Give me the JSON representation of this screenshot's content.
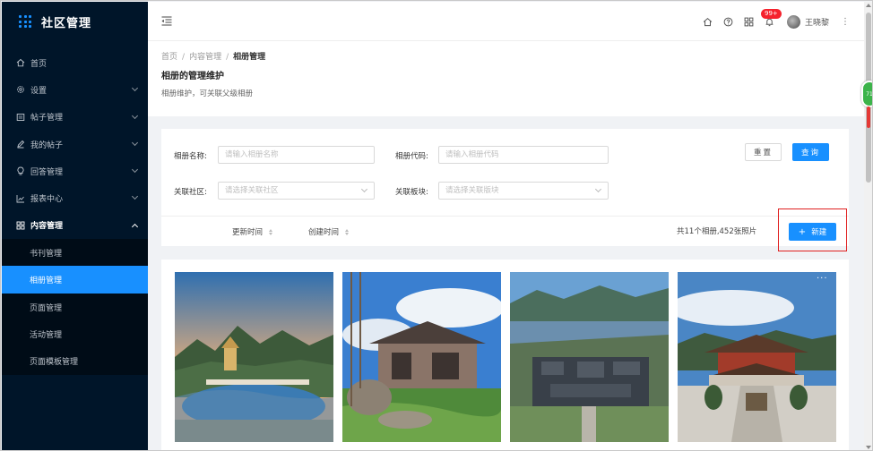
{
  "app": {
    "title": "社区管理"
  },
  "sidebar": {
    "items": [
      {
        "label": "首页",
        "icon": "home-icon",
        "has_arrow": false
      },
      {
        "label": "设置",
        "icon": "gear-icon",
        "has_arrow": true
      },
      {
        "label": "帖子管理",
        "icon": "post-icon",
        "has_arrow": true
      },
      {
        "label": "我的帖子",
        "icon": "edit-icon",
        "has_arrow": true
      },
      {
        "label": "回答管理",
        "icon": "bulb-icon",
        "has_arrow": true
      },
      {
        "label": "报表中心",
        "icon": "chart-icon",
        "has_arrow": true
      },
      {
        "label": "内容管理",
        "icon": "apps-icon",
        "has_arrow": true,
        "open": true
      }
    ],
    "subitems": [
      {
        "label": "书刊管理",
        "active": false
      },
      {
        "label": "相册管理",
        "active": true
      },
      {
        "label": "页面管理",
        "active": false
      },
      {
        "label": "活动管理",
        "active": false
      },
      {
        "label": "页面模板管理",
        "active": false
      }
    ]
  },
  "header": {
    "badge": "99+",
    "username": "王晓黎"
  },
  "breadcrumb": {
    "home": "首页",
    "parent": "内容管理",
    "current": "相册管理",
    "separator": "/"
  },
  "page": {
    "title": "相册的管理维护",
    "desc": "相册维护，可关联父级相册"
  },
  "filter": {
    "name_label": "相册名称:",
    "name_placeholder": "请输入相册名称",
    "code_label": "相册代码:",
    "code_placeholder": "请输入相册代码",
    "community_label": "关联社区:",
    "community_placeholder": "请选择关联社区",
    "board_label": "关联板块:",
    "board_placeholder": "请选择关联版块",
    "reset_label": "重置",
    "search_label": "查询"
  },
  "toolbar": {
    "sort_update": "更新时间",
    "sort_create": "创建时间",
    "summary": "共11个相册,452张照片",
    "new_label": "新建",
    "new_prefix": "+"
  },
  "gallery": {
    "more_label": "···",
    "photos": [
      {
        "name": "photo-lake-temple"
      },
      {
        "name": "photo-courtyard-house"
      },
      {
        "name": "photo-aerial-complex"
      },
      {
        "name": "photo-temple-hall"
      }
    ]
  },
  "widget": {
    "label": "71"
  },
  "colors": {
    "sidebar_bg": "#001529",
    "primary": "#1890ff",
    "highlight": "#e02020"
  }
}
